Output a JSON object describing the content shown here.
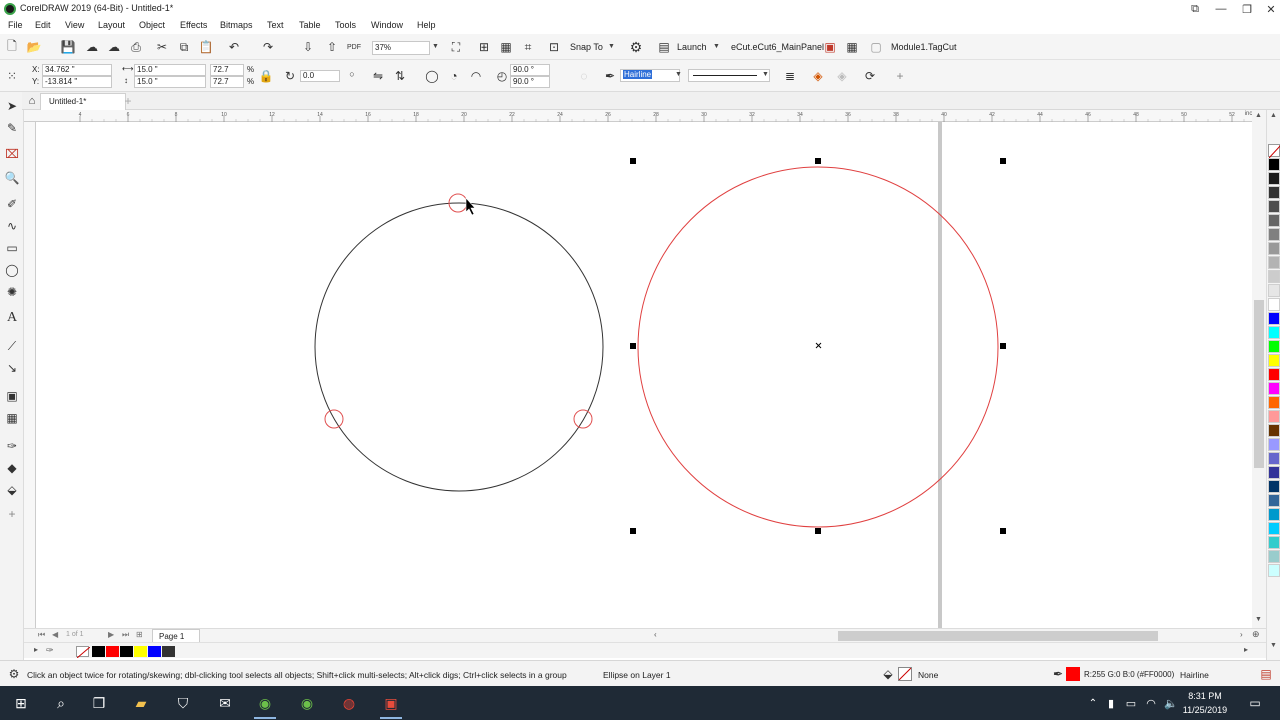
{
  "window": {
    "title": "CorelDRAW 2019 (64-Bit) - Untitled-1*",
    "minimize_icon": "minimize-icon",
    "restore_icon": "restore-icon",
    "close_icon": "close-icon"
  },
  "menu": {
    "items": [
      "File",
      "Edit",
      "View",
      "Layout",
      "Object",
      "Effects",
      "Bitmaps",
      "Text",
      "Table",
      "Tools",
      "Window",
      "Help"
    ]
  },
  "standard_toolbar": {
    "zoom": "37%",
    "snap_to": "Snap To",
    "launch": "Launch",
    "panel": "eCut.eCut6_MainPanel",
    "module": "Module1.TagCut"
  },
  "property_bar": {
    "x_label": "X:",
    "x_value": "34.762 \"",
    "y_label": "Y:",
    "y_value": "-13.814 \"",
    "width": "15.0 \"",
    "height": "15.0 \"",
    "scale_x": "72.7",
    "scale_y": "72.7",
    "percent": "%",
    "rotation": "0.0",
    "angle_start": "90.0 °",
    "angle_end": "90.0 °",
    "outline_width": "Hairline"
  },
  "document": {
    "tab": "Untitled-1*",
    "page_label": "Page 1",
    "page_count": "1 of 1"
  },
  "ruler": {
    "units": "inches",
    "ticks": [
      "4",
      "6",
      "8",
      "10",
      "12",
      "14",
      "16",
      "18",
      "20",
      "22",
      "24",
      "26",
      "28",
      "30",
      "32",
      "34",
      "36",
      "38",
      "40",
      "42",
      "44",
      "46",
      "48",
      "50",
      "52"
    ]
  },
  "palette": {
    "colors": [
      "#000000",
      "#1a1a1a",
      "#333333",
      "#4d4d4d",
      "#666666",
      "#808080",
      "#999999",
      "#b3b3b3",
      "#cccccc",
      "#e6e6e6",
      "#ffffff",
      "#0000ff",
      "#00ffff",
      "#00ff00",
      "#ffff00",
      "#ff0000",
      "#ff00ff",
      "#ff6600",
      "#ff9999",
      "#663300",
      "#9999ff",
      "#6666cc",
      "#333399",
      "#003366",
      "#336699",
      "#0099cc",
      "#00ccff",
      "#33cccc",
      "#99cccc",
      "#ccffff"
    ]
  },
  "doc_palette": {
    "colors": [
      "#000000",
      "#ff0000",
      "#000000",
      "#ffff00",
      "#0000ff",
      "#333333"
    ]
  },
  "status": {
    "hint": "Click an object twice for rotating/skewing; dbl-clicking tool selects all objects; Shift+click multi-selects; Alt+click digs; Ctrl+click selects in a group",
    "object": "Ellipse on Layer 1",
    "fill": "None",
    "outline_color": "R:255 G:0 B:0 (#FF0000)",
    "outline_width": "Hairline",
    "fill_color": "#ff0000"
  },
  "taskbar": {
    "time": "8:31 PM",
    "date": "11/25/2019"
  }
}
